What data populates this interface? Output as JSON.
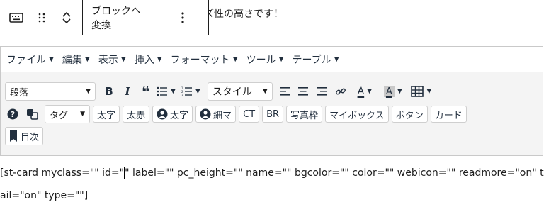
{
  "background_text": "ズ性の高さです！",
  "block_toolbar": {
    "convert_label": "ブロックへ変換",
    "more_icon": "more-vertical-icon"
  },
  "menubar": {
    "items": [
      "ファイル",
      "編集",
      "表示",
      "挿入",
      "フォーマット",
      "ツール",
      "テーブル"
    ]
  },
  "toolbar": {
    "format_select": "段落",
    "style_label": "スタイル",
    "tag_label": "タグ",
    "buttons_row2": [
      "太字",
      "太赤"
    ],
    "user_bold": "太字",
    "user_thin": "細マ",
    "ct": "CT",
    "br": "BR",
    "photo_frame": "写真枠",
    "mybox": "マイボックス",
    "button": "ボタン",
    "card": "カード",
    "toc": "目次"
  },
  "content": {
    "line1_before": "[st-card myclass=\"\" id=\"",
    "line1_after": "\" label=\"\" pc_height=\"\" name=\"\" bgcolor=\"\" color=\"\" webicon=\"\" readmore=\"on\" thumbn",
    "line2": "ail=\"on\" type=\"\"]"
  }
}
